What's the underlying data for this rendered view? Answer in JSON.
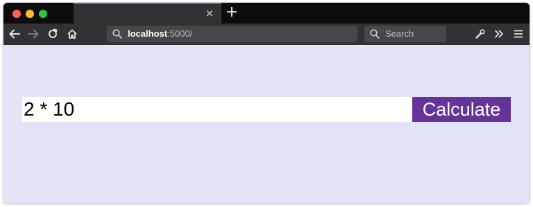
{
  "browser": {
    "url_host": "localhost",
    "url_path": ":5000/",
    "search_placeholder": "Search",
    "tab_close_glyph": "×",
    "new_tab_glyph": "+",
    "accent_color": "#0a84ff"
  },
  "icons": {
    "nav": [
      "back-icon",
      "forward-icon",
      "reload-icon",
      "home-icon"
    ],
    "toolbar": [
      "wrench-icon",
      "overflow-chevrons-icon",
      "hamburger-menu-icon"
    ]
  },
  "page": {
    "background_color": "#e4e4f8",
    "expression_value": "2 * 10",
    "calculate_label": "Calculate",
    "button_color": "#663399"
  }
}
